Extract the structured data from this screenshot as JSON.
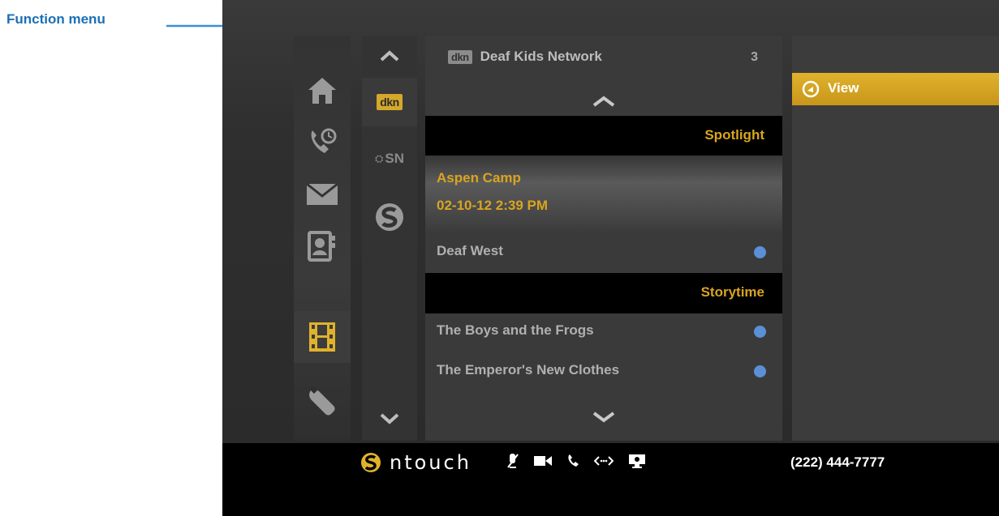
{
  "callout": {
    "label": "Function menu"
  },
  "left_rail": {
    "items": [
      {
        "icon": "home-icon"
      },
      {
        "icon": "call-history-icon"
      },
      {
        "icon": "mail-icon"
      },
      {
        "icon": "contacts-icon"
      },
      {
        "icon": "video-film-icon",
        "active": true
      },
      {
        "icon": "settings-wrench-icon"
      }
    ]
  },
  "channel_rail": {
    "items": [
      {
        "label": "dkn",
        "active": true
      },
      {
        "label": "SN"
      },
      {
        "icon": "sorenson-logo-icon"
      }
    ]
  },
  "list": {
    "header_badge": "dkn",
    "title": "Deaf Kids Network",
    "count": "3",
    "sections": [
      {
        "label": "Spotlight"
      },
      {
        "label": "Storytime"
      }
    ],
    "selected": {
      "title": "Aspen Camp",
      "date": "02-10-12  2:39 PM"
    },
    "items": [
      {
        "label": "Deaf West"
      },
      {
        "label": "The Boys and the Frogs"
      },
      {
        "label": "The Emperor's New Clothes"
      }
    ]
  },
  "function_menu": {
    "items": [
      {
        "label": "View",
        "icon": "view-play-icon"
      }
    ]
  },
  "bottom_bar": {
    "brand": "ntouch",
    "phone": "(222) 444-7777",
    "status_icons": [
      "mute-icon",
      "video-camera-icon",
      "phone-icon",
      "connection-icon",
      "screen-share-icon"
    ]
  },
  "colors": {
    "accent": "#d9a520",
    "callout": "#1a6fb5",
    "dot": "#5b8fd6"
  }
}
